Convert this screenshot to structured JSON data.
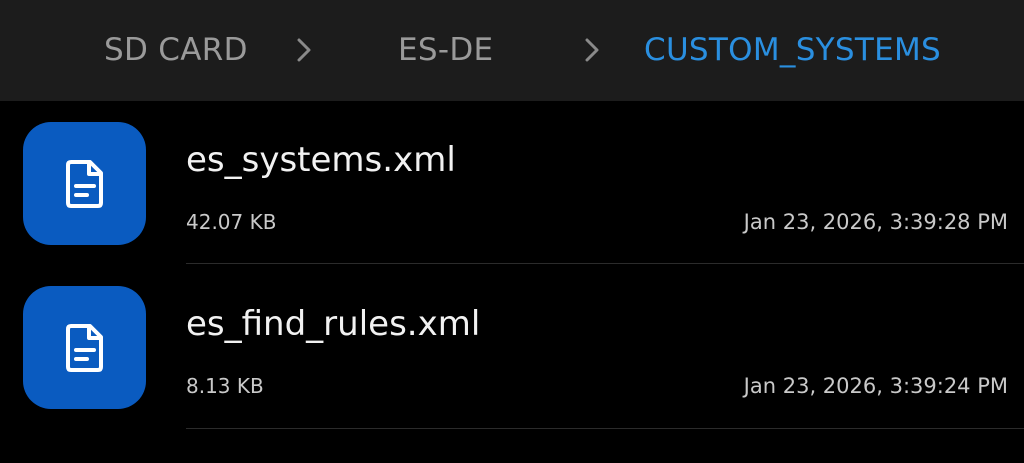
{
  "breadcrumb": {
    "items": [
      {
        "label": "SD CARD"
      },
      {
        "label": "ES-DE"
      },
      {
        "label": "CUSTOM_SYSTEMS"
      }
    ],
    "separator_icon": "chevron-right-icon"
  },
  "files": [
    {
      "name": "es_systems.xml",
      "size": "42.07 KB",
      "modified": "Jan 23, 2026, 3:39:28 PM",
      "icon": "document-icon"
    },
    {
      "name": "es_find_rules.xml",
      "size": "8.13 KB",
      "modified": "Jan 23, 2026, 3:39:24 PM",
      "icon": "document-icon"
    }
  ],
  "colors": {
    "header_background": "#1c1c1c",
    "background": "#000000",
    "active_crumb": "#2a8fe0",
    "inactive_crumb": "#9a9a9a",
    "file_icon_background": "#0a5bc0"
  }
}
